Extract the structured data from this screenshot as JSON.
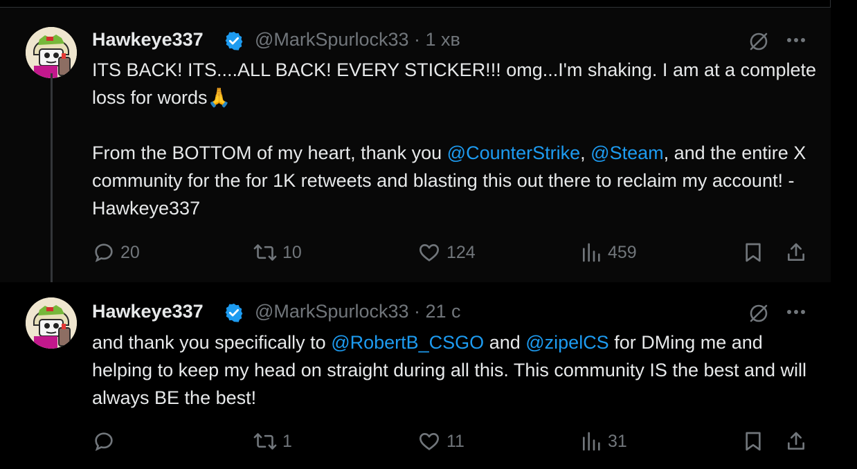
{
  "tweets": [
    {
      "name": "Hawkeye337",
      "handle": "@MarkSpurlock33 · 1 хв",
      "text": {
        "p1": "ITS BACK! ITS....ALL BACK! EVERY STICKER!!! omg...I'm shaking. I am at a complete loss for words🙏",
        "p2_a": "From the BOTTOM of my heart, thank you ",
        "p2_m1": "@CounterStrike",
        "p2_b": ", ",
        "p2_m2": "@Steam",
        "p2_c": ",  and the entire X community for the for 1K retweets and blasting this out there to reclaim my account! - Hawkeye337"
      },
      "metrics": {
        "replies": "20",
        "retweets": "10",
        "likes": "124",
        "views": "459"
      }
    },
    {
      "name": "Hawkeye337",
      "handle": "@MarkSpurlock33 · 21 с",
      "text": {
        "a": "and thank you specifically to ",
        "m1": "@RobertB_CSGO",
        "b": " and ",
        "m2": "@zipelCS",
        "c": " for DMing me and helping to keep my head on straight during all this. This community IS the best and will always BE the best!"
      },
      "metrics": {
        "replies": "",
        "retweets": "1",
        "likes": "11",
        "views": "31"
      }
    }
  ],
  "icons": {
    "verified": "verified-badge-icon",
    "grok": "grok-icon",
    "more": "more-dots-icon",
    "reply": "reply-icon",
    "retweet": "retweet-icon",
    "like": "like-heart-icon",
    "views": "views-chart-icon",
    "bookmark": "bookmark-icon",
    "share": "share-icon"
  },
  "colors": {
    "accent": "#1d9bf0",
    "muted": "#71767b",
    "text": "#e7e9ea",
    "background": "#000000"
  }
}
